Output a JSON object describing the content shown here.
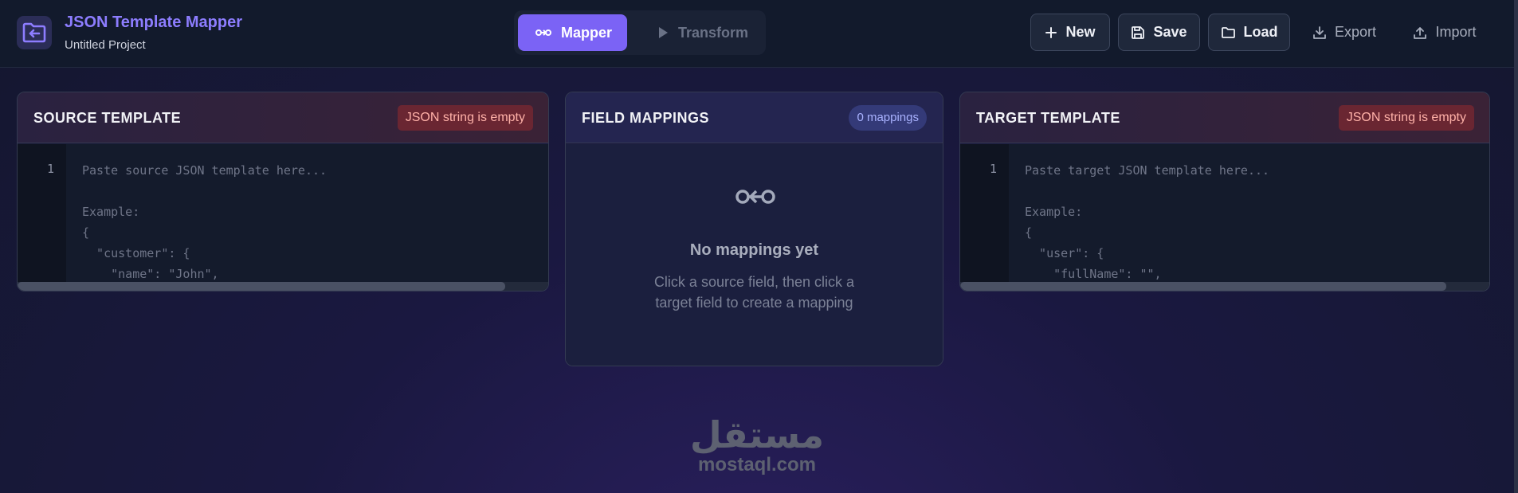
{
  "header": {
    "title": "JSON Template Mapper",
    "subtitle": "Untitled Project",
    "modes": [
      {
        "label": "Mapper",
        "active": true
      },
      {
        "label": "Transform",
        "active": false
      }
    ],
    "actions": {
      "new": "New",
      "save": "Save",
      "load": "Load",
      "export": "Export",
      "import": "Import"
    }
  },
  "source": {
    "title": "SOURCE TEMPLATE",
    "status": "JSON string is empty",
    "line_number": "1",
    "placeholder": "Paste source JSON template here...\n\nExample:\n{\n  \"customer\": {\n    \"name\": \"John\","
  },
  "mappings": {
    "title": "FIELD MAPPINGS",
    "count_label": "0 mappings",
    "empty_title": "No mappings yet",
    "empty_description": "Click a source field, then click a target field to create a mapping"
  },
  "target": {
    "title": "TARGET TEMPLATE",
    "status": "JSON string is empty",
    "line_number": "1",
    "placeholder": "Paste target JSON template here...\n\nExample:\n{\n  \"user\": {\n    \"fullName\": \"\","
  },
  "watermark": {
    "arabic": "مستقل",
    "latin": "mostaql.com"
  },
  "colors": {
    "accent": "#7b63f5",
    "title": "#8d7dff",
    "error_bg": "#6a2632",
    "error_text": "#ffb1a8"
  }
}
